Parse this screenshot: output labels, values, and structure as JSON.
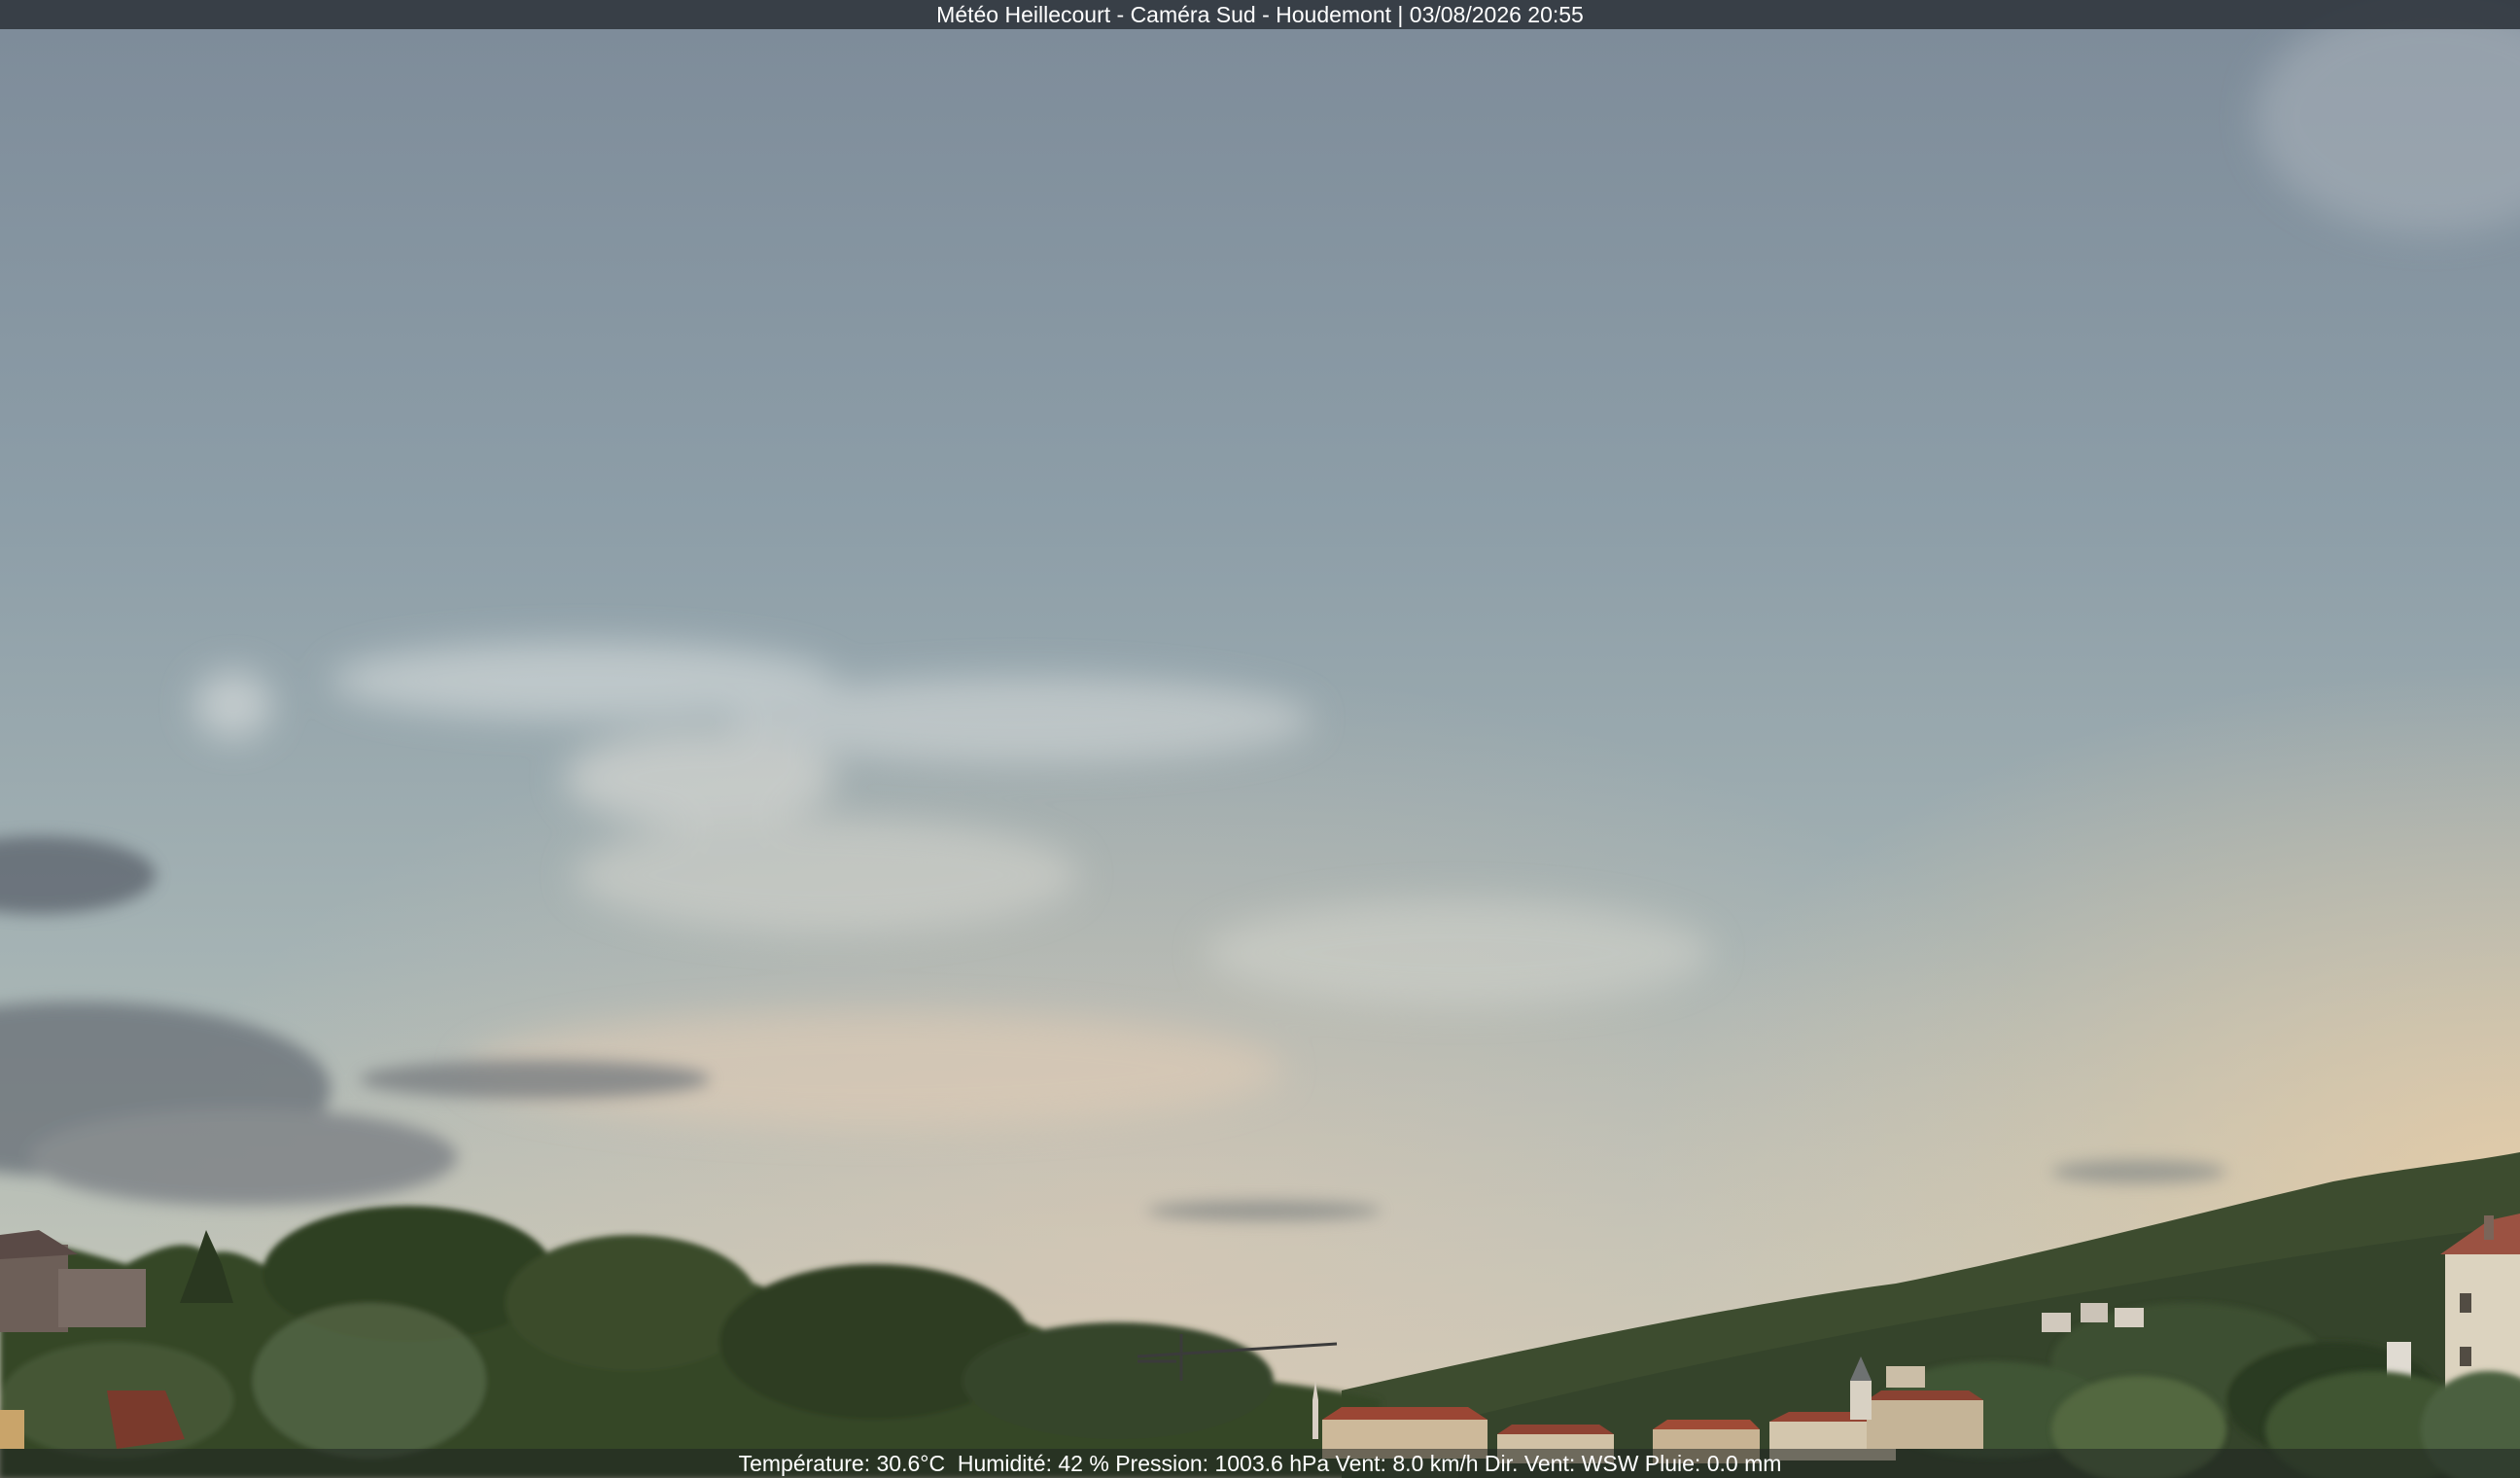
{
  "camera": {
    "title": "Météo Heillecourt - Caméra Sud - Houdemont | 03/08/2026 20:55"
  },
  "weather": {
    "line": "Température: 30.6°C  Humidité: 42 % Pression: 1003.6 hPa Vent: 8.0 km/h Dir. Vent: WSW Pluie: 0.0 mm"
  },
  "colors": {
    "sky_top": "#7f8d9a",
    "sky_mid": "#93a6ae",
    "sky_low": "#b3bbb4",
    "horizon_glow": "#d8c2a8",
    "trees_dark": "#2b3a22",
    "trees_mid": "#3f522f",
    "roof_red": "#9a4a35"
  }
}
